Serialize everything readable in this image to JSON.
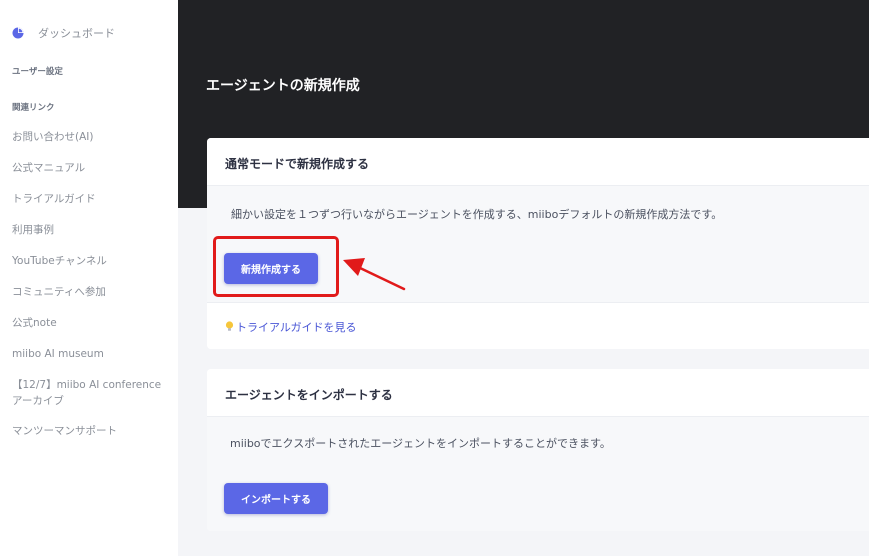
{
  "sidebar": {
    "dashboard": "ダッシュボード",
    "user_settings": "ユーザー設定",
    "related_links": "関連リンク",
    "links": [
      "お問い合わせ(AI)",
      "公式マニュアル",
      "トライアルガイド",
      "利用事例",
      "YouTubeチャンネル",
      "コミュニティへ参加",
      "公式note",
      "miibo AI museum",
      "【12/7】miibo AI conference",
      "アーカイブ",
      "マンツーマンサポート"
    ]
  },
  "main": {
    "title": "エージェントの新規作成",
    "normal_card": {
      "title": "通常モードで新規作成する",
      "description": "細かい設定を１つずつ行いながらエージェントを作成する、miiboデフォルトの新規作成方法です。",
      "button_label": "新規作成する",
      "guide_link": "トライアルガイドを見る"
    },
    "import_card": {
      "title": "エージェントをインポートする",
      "description": "miiboでエクスポートされたエージェントをインポートすることができます。",
      "button_label": "インポートする"
    }
  },
  "colors": {
    "accent": "#5b67e6",
    "header_bg": "#212225",
    "annotation": "#e11a1a"
  },
  "icons": {
    "dashboard": "pie-chart-icon",
    "guide": "lightbulb-icon"
  }
}
